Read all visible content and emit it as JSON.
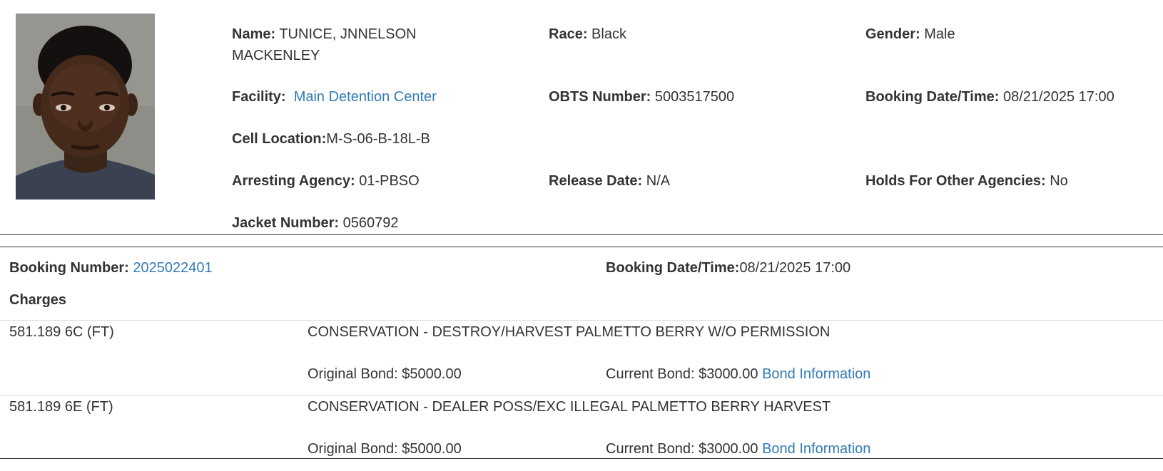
{
  "inmate": {
    "photo_label": "inmate-photo",
    "name_label": "Name:",
    "name_value": "TUNICE, JNNELSON MACKENLEY",
    "race_label": "Race:",
    "race_value": "Black",
    "gender_label": "Gender:",
    "gender_value": "Male",
    "facility_label": "Facility:",
    "facility_value": "Main Detention Center",
    "obts_label": "OBTS Number:",
    "obts_value": "5003517500",
    "booking_dt_label": "Booking Date/Time:",
    "booking_dt_value": "08/21/2025 17:00",
    "cell_label": "Cell Location:",
    "cell_value": "M-S-06-B-18L-B",
    "agency_label": "Arresting Agency:",
    "agency_value": "01-PBSO",
    "release_label": "Release Date:",
    "release_value": "N/A",
    "holds_label": "Holds For Other Agencies:",
    "holds_value": "No",
    "jacket_label": "Jacket Number:",
    "jacket_value": "0560792"
  },
  "booking": {
    "number_label": "Booking Number:",
    "number_value": "2025022401",
    "datetime_label": "Booking Date/Time:",
    "datetime_value": "08/21/2025 17:00",
    "charges_heading": "Charges"
  },
  "charges": [
    {
      "code": "581.189 6C (FT)",
      "description": "CONSERVATION - DESTROY/HARVEST PALMETTO BERRY W/O PERMISSION",
      "original_bond": "Original Bond: $5000.00",
      "current_bond": "Current Bond: $3000.00",
      "bond_link": "Bond Information"
    },
    {
      "code": "581.189 6E (FT)",
      "description": "CONSERVATION - DEALER POSS/EXC ILLEGAL PALMETTO BERRY HARVEST",
      "original_bond": "Original Bond: $5000.00",
      "current_bond": "Current Bond: $3000.00",
      "bond_link": "Bond Information"
    }
  ]
}
